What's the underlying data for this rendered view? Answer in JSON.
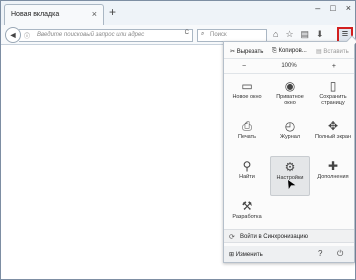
{
  "tab": {
    "title": "Новая вкладка",
    "close": "×",
    "new": "+"
  },
  "window_buttons": [
    "–",
    "□",
    "×"
  ],
  "urlbar": {
    "placeholder": "Введите поисковый запрос или адрес",
    "info_icon": "ⓘ",
    "reload": "C"
  },
  "searchbar": {
    "placeholder": "Поиск",
    "icon": "⌕"
  },
  "nav_icons": {
    "back": "◄",
    "home": "⌂",
    "star": "☆",
    "list": "▤",
    "download": "⬇",
    "menu": "≡"
  },
  "edit": {
    "cut": "✂ Вырезать",
    "copy": "⎘ Копиров...",
    "paste": "▤ Вставить"
  },
  "zoom": {
    "minus": "−",
    "value": "100%",
    "plus": "+"
  },
  "menu_items": [
    {
      "label": "Новое окно",
      "icon": "▭"
    },
    {
      "label": "Приватное окно",
      "icon": "◉"
    },
    {
      "label": "Сохранить страницу",
      "icon": "▯"
    },
    {
      "label": "Печать",
      "icon": "⎙"
    },
    {
      "label": "Журнал",
      "icon": "◴"
    },
    {
      "label": "Полный экран",
      "icon": "✥"
    },
    {
      "label": "Найти",
      "icon": "⚲"
    },
    {
      "label": "Настройки",
      "icon": "⚙"
    },
    {
      "label": "Дополнения",
      "icon": "✚"
    },
    {
      "label": "Разработка",
      "icon": "⚒"
    }
  ],
  "sync": {
    "label": "Войти в Синхронизацию",
    "icon": "⟳"
  },
  "footer": {
    "customize": "⊞ Изменить",
    "help": "?",
    "quit": "⏻"
  },
  "cursor": "➤"
}
